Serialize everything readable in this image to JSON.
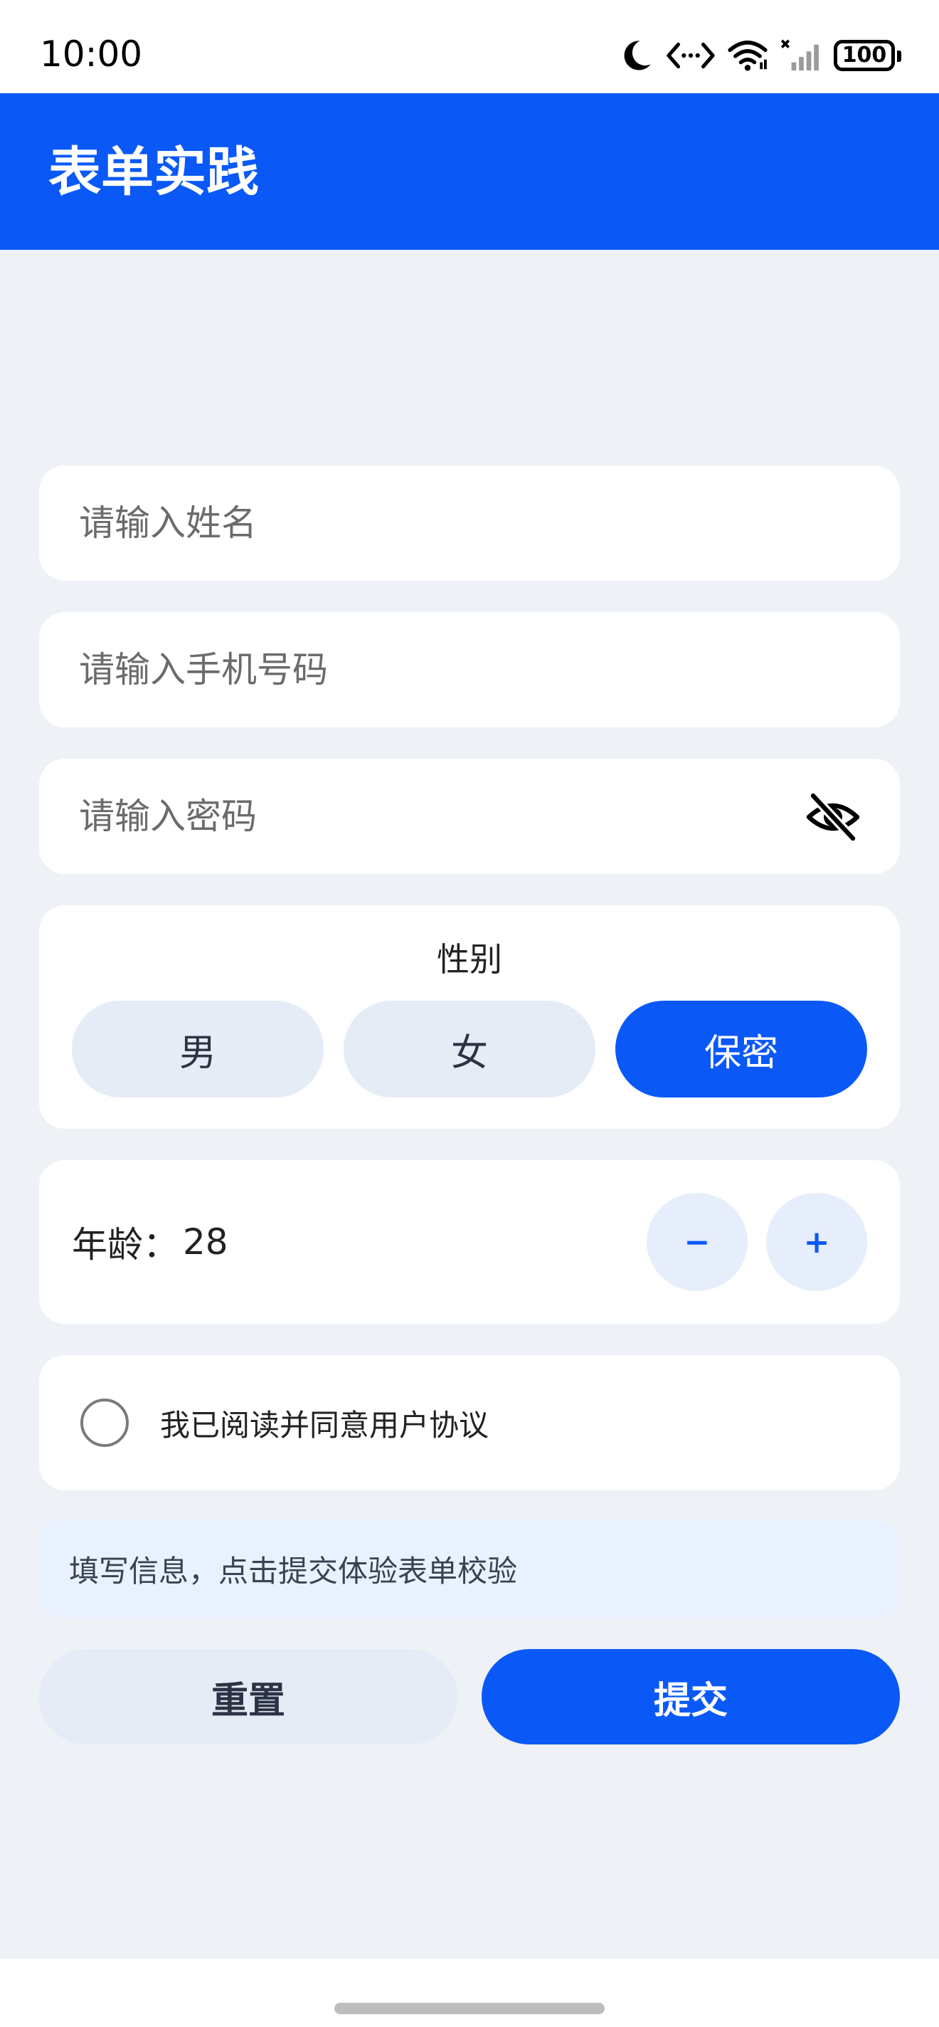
{
  "status_bar": {
    "time": "10:00",
    "battery": "100",
    "icons": [
      "moon-icon",
      "code-icon",
      "wifi-icon",
      "signal-icon",
      "battery-icon"
    ]
  },
  "header": {
    "title": "表单实践",
    "color": "#0a59f7"
  },
  "form": {
    "name_placeholder": "请输入姓名",
    "phone_placeholder": "请输入手机号码",
    "password_placeholder": "请输入密码",
    "password_visibility_icon": "eye-off-icon",
    "gender": {
      "title": "性别",
      "options": [
        "男",
        "女",
        "保密"
      ],
      "selected": "保密"
    },
    "age": {
      "label": "年龄：",
      "value": "28",
      "decrement": "−",
      "increment": "+"
    },
    "agreement": {
      "text": "我已阅读并同意用户协议",
      "checked": false
    },
    "hint": "填写信息，点击提交体验表单校验",
    "reset_label": "重置",
    "submit_label": "提交"
  },
  "colors": {
    "primary": "#0a59f7",
    "page_background": "#eef1f5",
    "card_background": "#ffffff",
    "secondary_button": "#e5ecf6",
    "hint_background": "#e8f1fd"
  }
}
